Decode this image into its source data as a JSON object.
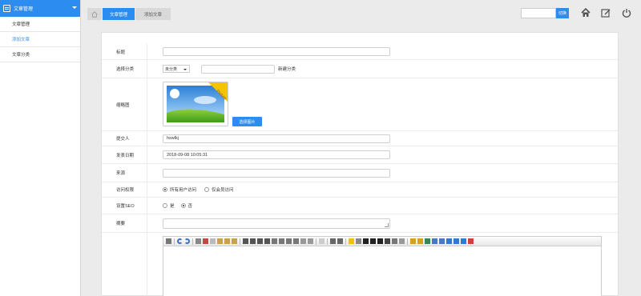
{
  "sidebar": {
    "header": "文章管理",
    "items": [
      {
        "label": "文章管理",
        "active": false
      },
      {
        "label": "添加文章",
        "active": true
      },
      {
        "label": "文章分类",
        "active": false
      }
    ]
  },
  "breadcrumb": [
    "文章管理",
    "添加文章"
  ],
  "search": {
    "value": "",
    "button": "切换"
  },
  "form": {
    "title_label": "标题",
    "title_value": "",
    "category_label": "选择分类",
    "category_selected": "未分类",
    "new_category_placeholder": "",
    "new_category_label": "新建分类",
    "thumb_label": "缩略图",
    "thumb_ribbon": "Picture",
    "choose_image": "选择图片",
    "submitter_label": "提交人",
    "submitter_value": "hswlkj",
    "date_label": "发表日期",
    "date_value": "2018-09-08 10:05:31",
    "source_label": "来源",
    "source_value": "",
    "access_label": "访问权限",
    "access_options": [
      "所有用户访问",
      "仅会员访问"
    ],
    "access_selected": 0,
    "seo_label": "设置SEO",
    "seo_options": [
      "是",
      "否"
    ],
    "seo_selected": 1,
    "summary_label": "摘要",
    "summary_value": ""
  },
  "colors": {
    "accent": "#2d8cf0",
    "background": "#ebebeb"
  }
}
